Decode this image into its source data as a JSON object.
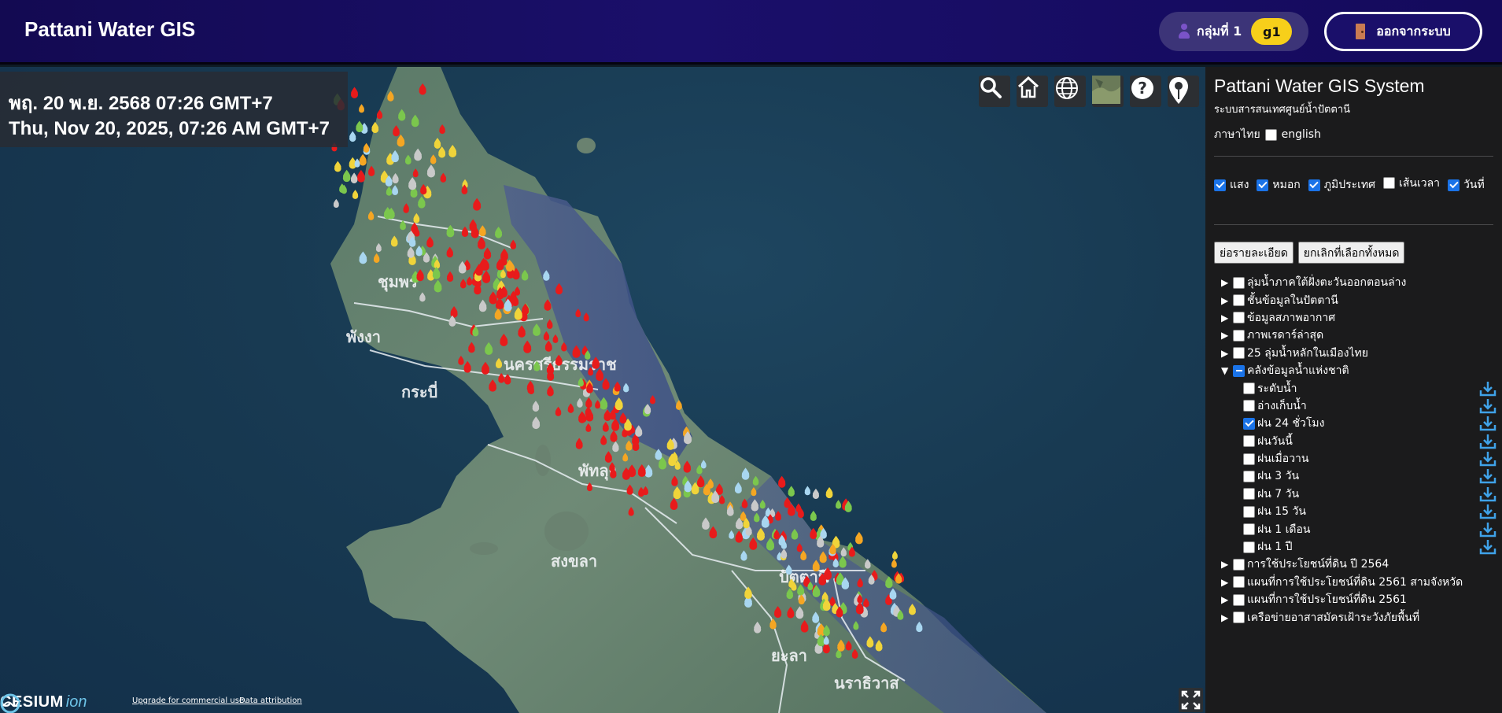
{
  "header": {
    "brand": "Pattani Water GIS",
    "group_label": "กลุ่มที่ 1",
    "group_badge": "g1",
    "logout_label": "ออกจากระบบ",
    "colors": {
      "bar": "#1a0f6a",
      "badge": "#f7cf1a"
    }
  },
  "map": {
    "datetime_thai": "พฤ. 20 พ.ย. 2568 07:26 GMT+7",
    "datetime_en": "Thu, Nov 20, 2025, 07:26 AM GMT+7",
    "toolbar": [
      "search-icon",
      "home-icon",
      "globe-icon",
      "imagery-icon",
      "help-icon",
      "map-pin-icon"
    ],
    "cesium_text": "CESIUM",
    "cesium_ion": "ion",
    "credit_upgrade": "Upgrade for commercial use.",
    "credit_attr": "Data attribution"
  },
  "panel": {
    "title": "Pattani Water GIS System",
    "subtitle": "ระบบสารสนเทศศูนย์น้ำปัตตานี",
    "lang_thai": "ภาษาไทย",
    "lang_en": "english",
    "layers": [
      {
        "label": "แสง",
        "checked": true
      },
      {
        "label": "หมอก",
        "checked": true
      },
      {
        "label": "ภูมิประเทศ",
        "checked": true
      },
      {
        "label": "เส้นเวลา",
        "checked": false
      },
      {
        "label": "วันที่",
        "checked": true
      }
    ],
    "btn_collapse": "ย่อรายละเอียด",
    "btn_uncheck": "ยกเลิกที่เลือกทั้งหมด",
    "tree": [
      {
        "label": "ลุ่มน้ำภาคใต้ฝั่งตะวันออกตอนล่าง",
        "expanded": false
      },
      {
        "label": "ชั้นข้อมูลในปัตตานี",
        "expanded": false
      },
      {
        "label": "ข้อมูลสภาพอากาศ",
        "expanded": false
      },
      {
        "label": "ภาพเรดาร์ล่าสุด",
        "expanded": false
      },
      {
        "label": "25 ลุ่มน้ำหลักในเมืองไทย",
        "expanded": false
      },
      {
        "label": "คลังข้อมูลน้ำแห่งชาติ",
        "expanded": true
      }
    ],
    "sub_items": [
      {
        "label": "ระดับน้ำ",
        "checked": false
      },
      {
        "label": "อ่างเก็บน้ำ",
        "checked": false
      },
      {
        "label": "ฝน 24 ชั่วโมง",
        "checked": true
      },
      {
        "label": "ฝนวันนี้",
        "checked": false
      },
      {
        "label": "ฝนเมื่อวาน",
        "checked": false
      },
      {
        "label": "ฝน 3 วัน",
        "checked": false
      },
      {
        "label": "ฝน 7 วัน",
        "checked": false
      },
      {
        "label": "ฝน 15 วัน",
        "checked": false
      },
      {
        "label": "ฝน 1 เดือน",
        "checked": false
      },
      {
        "label": "ฝน 1 ปี",
        "checked": false
      }
    ],
    "tree_after": [
      {
        "label": "การใช้ประโยชน์ที่ดิน ปี 2564"
      },
      {
        "label": "แผนที่การใช้ประโยชน์ที่ดิน 2561 สามจังหวัด"
      },
      {
        "label": "แผนที่การใช้ประโยชน์ที่ดิน 2561"
      },
      {
        "label": "เครือข่ายอาสาสมัครเฝ้าระวังภัยพื้นที่"
      }
    ]
  }
}
